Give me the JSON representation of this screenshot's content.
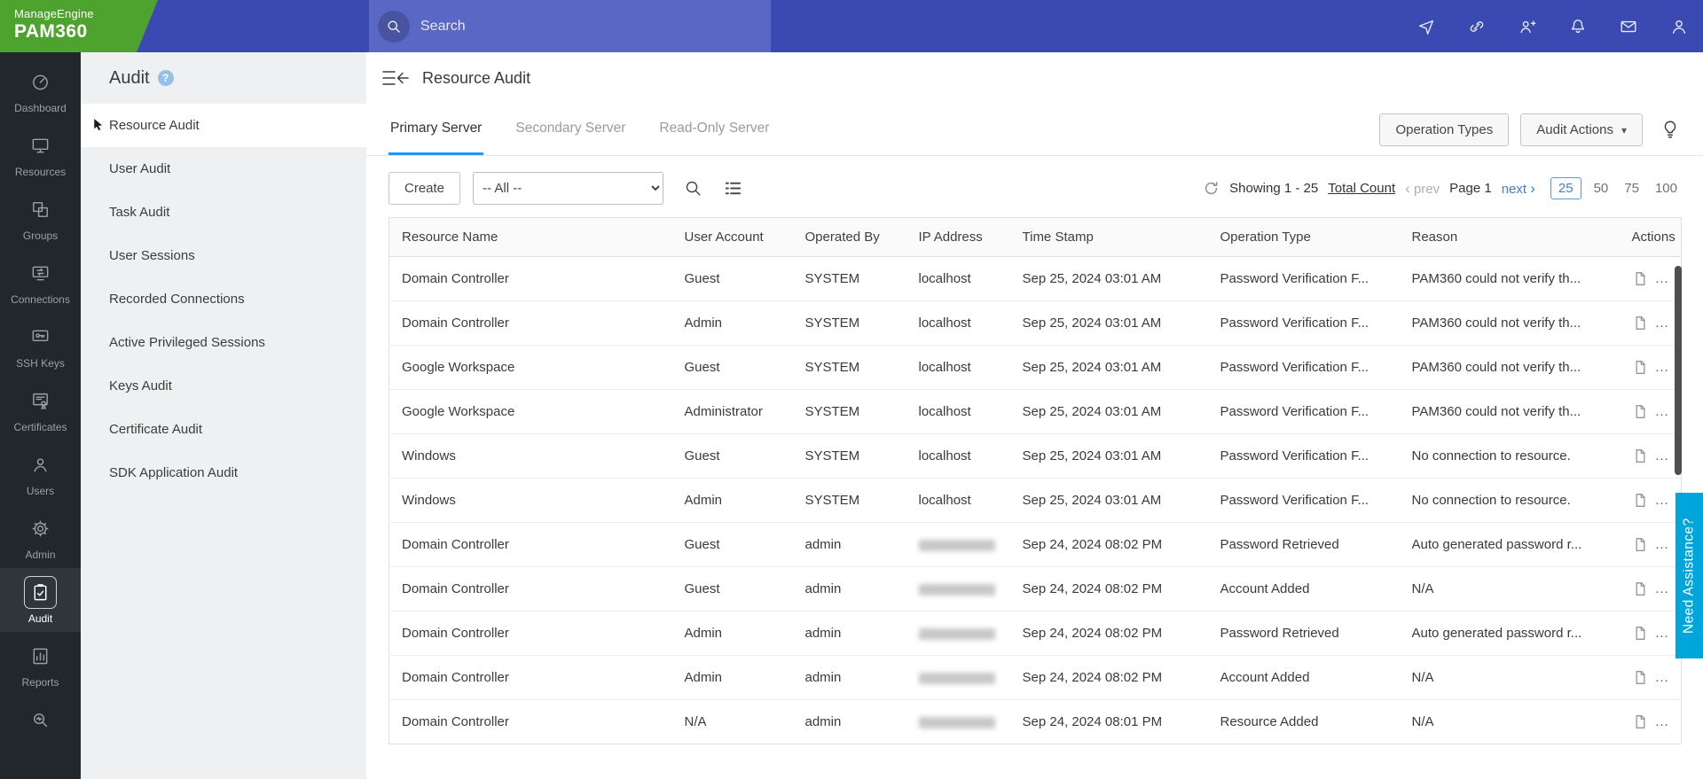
{
  "colors": {
    "brand_green": "#4ea32e",
    "topbar_blue": "#3b4ab2",
    "search_band_blue": "#5a67c5",
    "active_tab_blue": "#2196f3",
    "pagination_blue": "#3f82c6",
    "assist_cyan": "#00a5dc",
    "dark_nav": "#21272b",
    "sidebar_gray": "#eef0f1"
  },
  "topbar": {
    "brand_line1": "ManageEngine",
    "brand_line2": "PAM360",
    "search_placeholder": "Search",
    "icons": [
      "session-tracker",
      "link",
      "user-session",
      "notifications",
      "mail",
      "profile"
    ]
  },
  "primary_nav": [
    {
      "label": "Dashboard",
      "icon": "dashboard",
      "active": false
    },
    {
      "label": "Resources",
      "icon": "resources",
      "active": false
    },
    {
      "label": "Groups",
      "icon": "groups",
      "active": false
    },
    {
      "label": "Connections",
      "icon": "connections",
      "active": false
    },
    {
      "label": "SSH Keys",
      "icon": "sshkeys",
      "active": false
    },
    {
      "label": "Certificates",
      "icon": "certificates",
      "active": false
    },
    {
      "label": "Users",
      "icon": "users",
      "active": false
    },
    {
      "label": "Admin",
      "icon": "admin",
      "active": false
    },
    {
      "label": "Audit",
      "icon": "audit",
      "active": true
    },
    {
      "label": "Reports",
      "icon": "reports",
      "active": false
    },
    {
      "label": "",
      "icon": "discover",
      "active": false
    }
  ],
  "audit_menu": {
    "title": "Audit",
    "selected": "Resource Audit",
    "items": [
      "Resource Audit",
      "User Audit",
      "Task Audit",
      "User Sessions",
      "Recorded Connections",
      "Active Privileged Sessions",
      "Keys Audit",
      "Certificate Audit",
      "SDK Application Audit"
    ]
  },
  "main": {
    "title": "Resource Audit",
    "tabs": [
      {
        "label": "Primary Server",
        "active": true
      },
      {
        "label": "Secondary Server",
        "active": false
      },
      {
        "label": "Read-Only Server",
        "active": false
      }
    ],
    "operation_types_label": "Operation Types",
    "audit_actions_label": "Audit Actions",
    "create_label": "Create",
    "filter_value": "-- All --",
    "pagination": {
      "showing": "Showing 1 - 25",
      "total_count_label": "Total Count",
      "prev_label": "prev",
      "page_label": "Page 1",
      "next_label": "next",
      "sizes": [
        "25",
        "50",
        "75",
        "100"
      ],
      "active_size": "25"
    },
    "table": {
      "columns": [
        "Resource Name",
        "User Account",
        "Operated By",
        "IP Address",
        "Time Stamp",
        "Operation Type",
        "Reason",
        "Actions"
      ],
      "rows": [
        {
          "resource": "Domain Controller",
          "account": "Guest",
          "operated_by": "SYSTEM",
          "ip": "localhost",
          "ip_blurred": false,
          "time": "Sep 25, 2024 03:01 AM",
          "operation": "Password Verification F...",
          "reason": "PAM360 could not verify th..."
        },
        {
          "resource": "Domain Controller",
          "account": "Admin",
          "operated_by": "SYSTEM",
          "ip": "localhost",
          "ip_blurred": false,
          "time": "Sep 25, 2024 03:01 AM",
          "operation": "Password Verification F...",
          "reason": "PAM360 could not verify th..."
        },
        {
          "resource": "Google Workspace",
          "account": "Guest",
          "operated_by": "SYSTEM",
          "ip": "localhost",
          "ip_blurred": false,
          "time": "Sep 25, 2024 03:01 AM",
          "operation": "Password Verification F...",
          "reason": "PAM360 could not verify th..."
        },
        {
          "resource": "Google Workspace",
          "account": "Administrator",
          "operated_by": "SYSTEM",
          "ip": "localhost",
          "ip_blurred": false,
          "time": "Sep 25, 2024 03:01 AM",
          "operation": "Password Verification F...",
          "reason": "PAM360 could not verify th..."
        },
        {
          "resource": "Windows",
          "account": "Guest",
          "operated_by": "SYSTEM",
          "ip": "localhost",
          "ip_blurred": false,
          "time": "Sep 25, 2024 03:01 AM",
          "operation": "Password Verification F...",
          "reason": "No connection to resource."
        },
        {
          "resource": "Windows",
          "account": "Admin",
          "operated_by": "SYSTEM",
          "ip": "localhost",
          "ip_blurred": false,
          "time": "Sep 25, 2024 03:01 AM",
          "operation": "Password Verification F...",
          "reason": "No connection to resource."
        },
        {
          "resource": "Domain Controller",
          "account": "Guest",
          "operated_by": "admin",
          "ip": "",
          "ip_blurred": true,
          "time": "Sep 24, 2024 08:02 PM",
          "operation": "Password Retrieved",
          "reason": "Auto generated password r..."
        },
        {
          "resource": "Domain Controller",
          "account": "Guest",
          "operated_by": "admin",
          "ip": "",
          "ip_blurred": true,
          "time": "Sep 24, 2024 08:02 PM",
          "operation": "Account Added",
          "reason": "N/A"
        },
        {
          "resource": "Domain Controller",
          "account": "Admin",
          "operated_by": "admin",
          "ip": "",
          "ip_blurred": true,
          "time": "Sep 24, 2024 08:02 PM",
          "operation": "Password Retrieved",
          "reason": "Auto generated password r..."
        },
        {
          "resource": "Domain Controller",
          "account": "Admin",
          "operated_by": "admin",
          "ip": "",
          "ip_blurred": true,
          "time": "Sep 24, 2024 08:02 PM",
          "operation": "Account Added",
          "reason": "N/A"
        },
        {
          "resource": "Domain Controller",
          "account": "N/A",
          "operated_by": "admin",
          "ip": "",
          "ip_blurred": true,
          "time": "Sep 24, 2024 08:01 PM",
          "operation": "Resource Added",
          "reason": "N/A"
        }
      ]
    }
  },
  "need_assistance_label": "Need Assistance?"
}
